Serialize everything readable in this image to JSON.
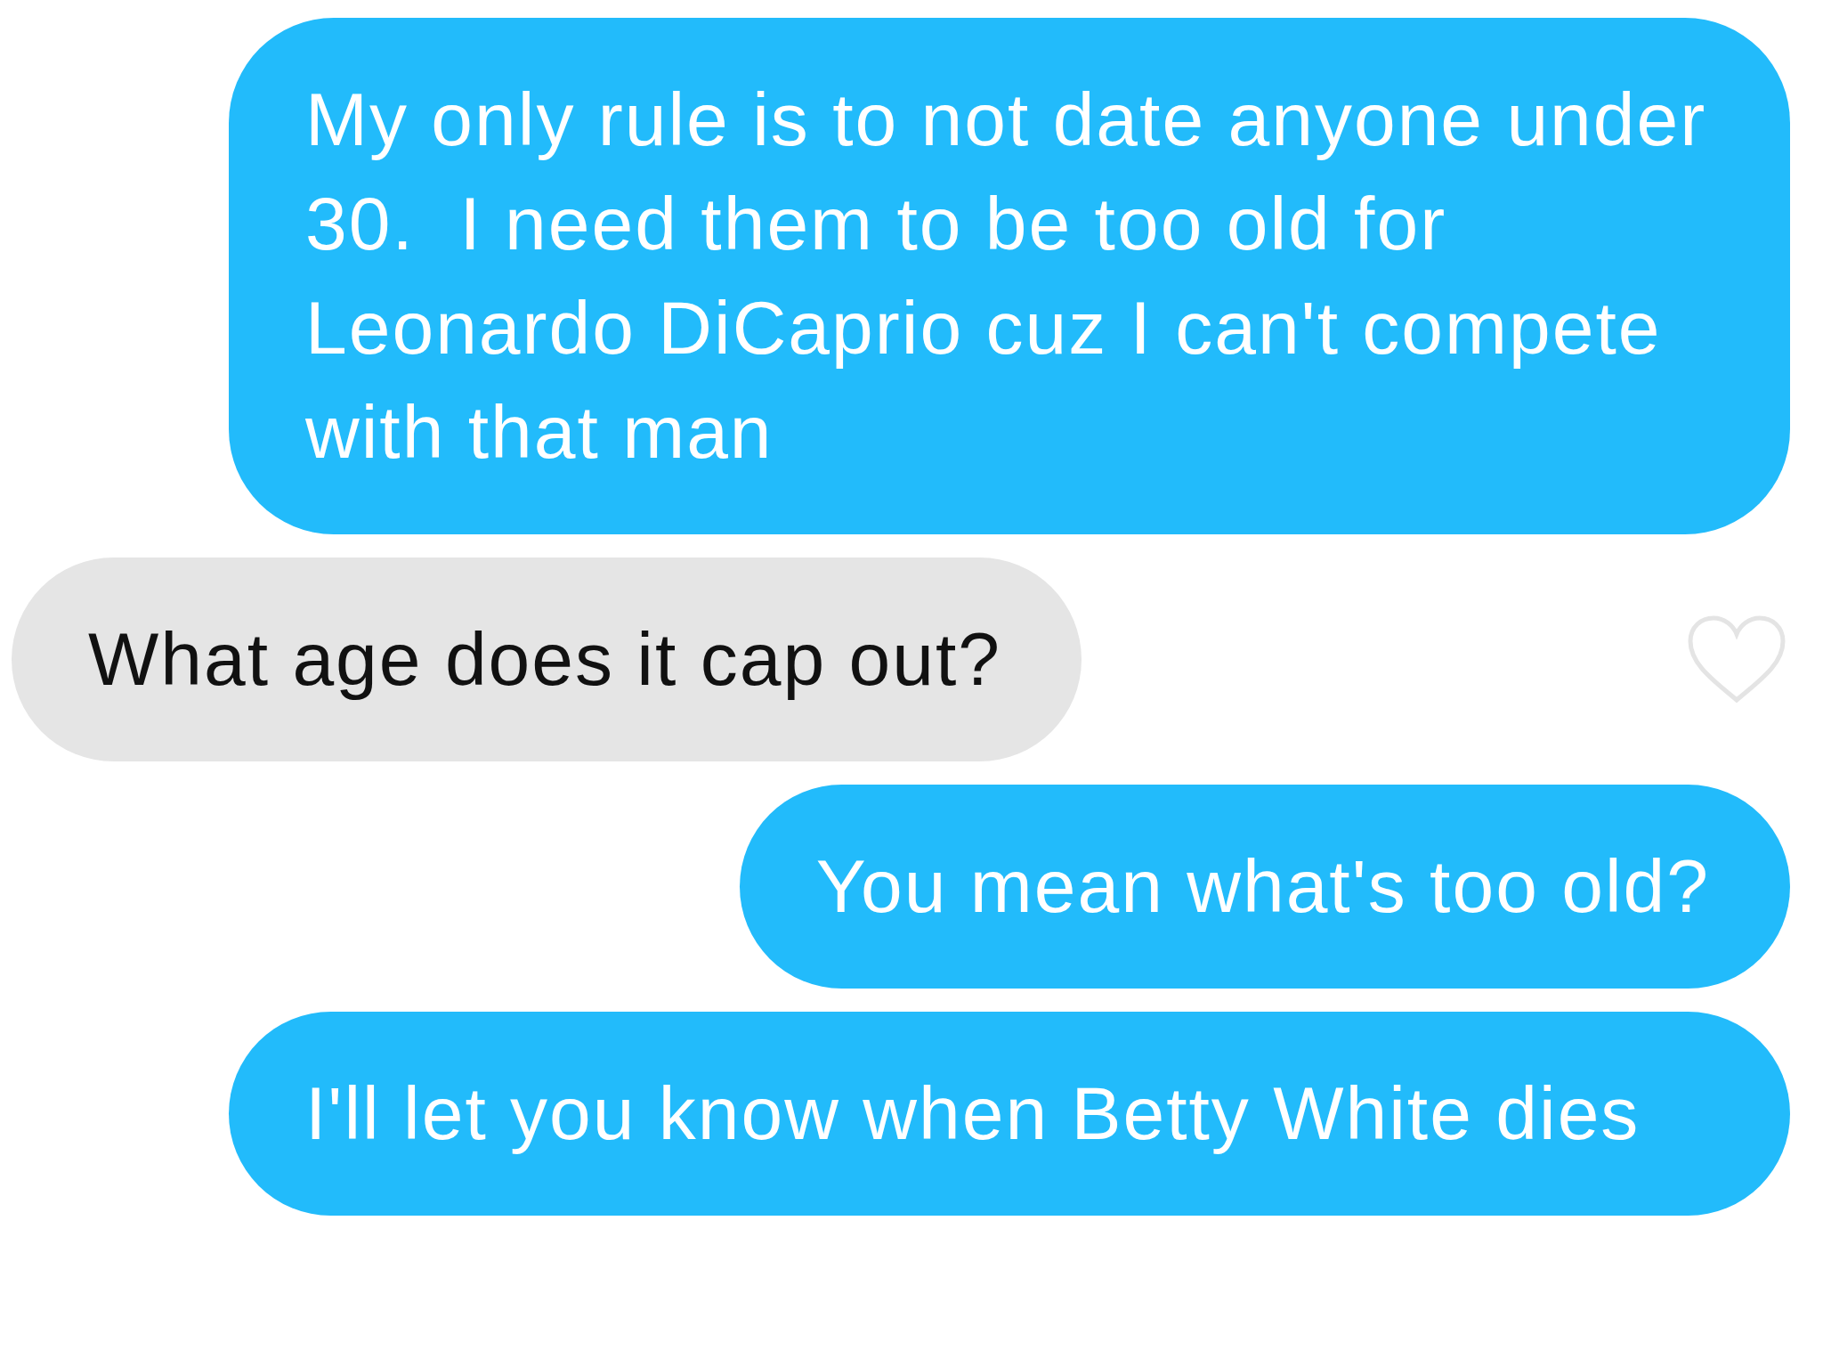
{
  "messages": [
    {
      "kind": "sent",
      "text": "My only rule is to not date anyone under 30.  I need them to be too old for Leonardo DiCaprio cuz I can't compete with that man"
    },
    {
      "kind": "received",
      "text": "What age does it cap out?",
      "liked": false
    },
    {
      "kind": "sent",
      "text": "You mean what's too old?"
    },
    {
      "kind": "sent",
      "text": "I'll let you know when Betty White dies"
    }
  ]
}
